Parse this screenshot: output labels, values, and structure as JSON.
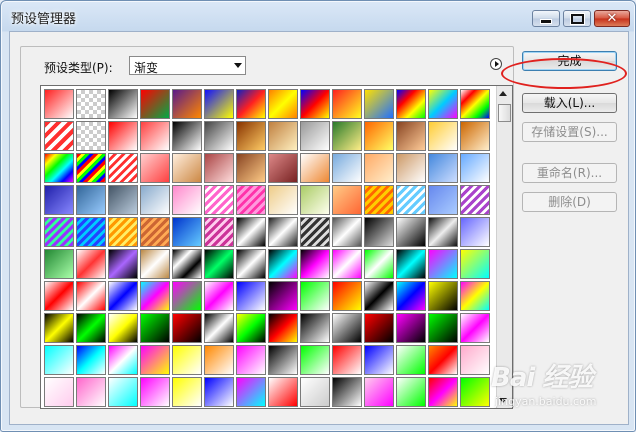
{
  "window": {
    "title": "预设管理器"
  },
  "preset": {
    "label": "预设类型(P):",
    "value": "渐变"
  },
  "buttons": {
    "done": "完成",
    "load": "载入(L)...",
    "save": "存储设置(S)...",
    "rename": "重命名(R)...",
    "delete": "删除(D)"
  },
  "watermark": {
    "logo": "Bai 经验",
    "url": "jingyan.baidu.com"
  },
  "colors": {
    "highlight_ring": "#e0211e",
    "default_button_border": "#3c7fb1"
  },
  "icons": {
    "menu": "flyout-menu-icon",
    "scroll_up": "scroll-up-arrow-icon",
    "scroll_down": "scroll-down-arrow-icon"
  },
  "swatches": [
    "linear-gradient(135deg,#ff2020,#ffffff)",
    "checker",
    "linear-gradient(135deg,#000000,#ffffff)",
    "linear-gradient(135deg,#ff0000,#00aa44)",
    "linear-gradient(135deg,#5a1a8a,#ff8800)",
    "linear-gradient(135deg,#1010ff,#ffff00)",
    "linear-gradient(135deg,#1020c0,#ff2020,#ffff00)",
    "linear-gradient(135deg,#ff8000,#ffff00,#ff8000)",
    "linear-gradient(135deg,#0000ff,#ff0000,#ffff00)",
    "linear-gradient(135deg,#ff2020,#ffff20)",
    "linear-gradient(135deg,#ffe000,#2070ff)",
    "linear-gradient(135deg,#0000ff,#ff0000,#ffff00,#00ff00)",
    "linear-gradient(135deg,#ffff00,#00ccff,#ff00ff)",
    "linear-gradient(135deg,#ffffff,#ff0000,#ffff00,#00ff00,#0000ff)",
    "repeating-linear-gradient(135deg,#ff3030 0 4px,#ffffff 4px 8px)",
    "checker",
    "linear-gradient(135deg,#ff0000,#ffffff)",
    "linear-gradient(135deg,#ff4040,#ffffff)",
    "linear-gradient(135deg,#000000,#ffffff)",
    "linear-gradient(135deg,#444444,#ffffff)",
    "linear-gradient(135deg,#883300,#ffcc66)",
    "linear-gradient(135deg,#c08040,#fff0c0)",
    "linear-gradient(135deg,#999999,#ffffff)",
    "linear-gradient(135deg,#2a7a2a,#ffee88)",
    "linear-gradient(135deg,#ff6600,#ffff66)",
    "linear-gradient(135deg,#884422,#ffcc99)",
    "linear-gradient(135deg,#ffcc33,#ffffff)",
    "linear-gradient(135deg,#cc6600,#ffeecc)",
    "linear-gradient(135deg,#ff0000,#ffff00,#00ff00,#00ffff,#0000ff,#ff00ff)",
    "repeating-linear-gradient(135deg,#ff0000 0 3px,#ffff00 3px 6px,#00ff00 6px 9px,#0000ff 9px 12px)",
    "repeating-linear-gradient(135deg,#ffffff 0 3px,#ff3030 3px 6px)",
    "linear-gradient(135deg,#ffd0d0,#ff4040)",
    "linear-gradient(135deg,#ffeedd,#cc8844)",
    "linear-gradient(135deg,#aa4444,#ffdddd)",
    "linear-gradient(135deg,#884422,#ffcc88)",
    "linear-gradient(135deg,#dd8888,#772222)",
    "linear-gradient(135deg,#ffffff,#ee8833)",
    "linear-gradient(135deg,#77aadd,#ffffff)",
    "linear-gradient(135deg,#ffaa66,#ffeecc)",
    "linear-gradient(135deg,#cc9966,#ffffff)",
    "linear-gradient(135deg,#4488dd,#ccddff)",
    "linear-gradient(135deg,#66aaff,#ffffff)",
    "linear-gradient(135deg,#2020aa,#8888ff)",
    "linear-gradient(135deg,#336699,#99ccff)",
    "linear-gradient(135deg,#445566,#bbccdd)",
    "linear-gradient(135deg,#88aacc,#ffffff)",
    "linear-gradient(135deg,#ff88cc,#ffffff)",
    "repeating-linear-gradient(135deg,#ff66cc 0 3px,#ffffff 3px 6px)",
    "repeating-linear-gradient(135deg,#ff99dd 0 3px,#ff33aa 3px 6px)",
    "linear-gradient(135deg,#eecc88,#ffffff)",
    "linear-gradient(135deg,#aacc66,#ffffee)",
    "linear-gradient(135deg,#ffcc88,#ff6633)",
    "repeating-linear-gradient(135deg,#ffcc00 0 3px,#ff6600 3px 6px)",
    "repeating-linear-gradient(135deg,#66ccff 0 3px,#ffffff 3px 6px)",
    "linear-gradient(135deg,#6688ee,#aaccff)",
    "repeating-linear-gradient(135deg,#aa44cc 0 3px,#ffffff 3px 6px)",
    "repeating-linear-gradient(135deg,#9933ff 0 3px,#33ff99 3px 6px)",
    "repeating-linear-gradient(135deg,#2244ff 0 3px,#00ccff 3px 6px)",
    "repeating-linear-gradient(135deg,#ff9900 0 3px,#ffee66 3px 6px)",
    "repeating-linear-gradient(135deg,#cc6633 0 3px,#ffaa55 3px 6px)",
    "linear-gradient(135deg,#0033cc,#66ccff)",
    "repeating-linear-gradient(135deg,#cc3399 0 3px,#ffccee 3px 6px)",
    "linear-gradient(135deg,#000000,#ffffff,#000000)",
    "linear-gradient(135deg,#222222,#ffffff,#222222)",
    "repeating-linear-gradient(135deg,#333333 0 3px,#dddddd 3px 6px)",
    "linear-gradient(135deg,#555555,#ffffff,#555555)",
    "linear-gradient(135deg,#000000,#dddddd)",
    "linear-gradient(135deg,#ffffff,#000000)",
    "linear-gradient(135deg,#111111,#eeeeee,#111111)",
    "linear-gradient(135deg,#6666ff,#ffffff)",
    "linear-gradient(135deg,#228833,#aaffaa)",
    "linear-gradient(135deg,#ffffff,#ff3333,#ffffff)",
    "linear-gradient(135deg,#000000,#aa66ff,#000000)",
    "linear-gradient(135deg,#bb8844,#ffffff,#bb8844)",
    "linear-gradient(135deg,#000000,#ffffff,#000000,#ffffff)",
    "linear-gradient(135deg,#000000,#00ff66,#000000)",
    "linear-gradient(135deg,#000000,#ffffff,#000000)",
    "linear-gradient(135deg,#000000,#00ffff,#ff00ff)",
    "linear-gradient(135deg,#000000,#ff00ff,#ffffff)",
    "linear-gradient(135deg,#ff00ff,#ffffff,#ff00ff)",
    "linear-gradient(135deg,#00ff00,#ffffff,#00ff00)",
    "linear-gradient(135deg,#000000,#00ffff,#000000)",
    "linear-gradient(135deg,#ff00ff,#00ffff)",
    "linear-gradient(135deg,#ffff00,#00ffff)",
    "linear-gradient(135deg,#ffffff,#ff0000,#ffffff)",
    "linear-gradient(135deg,#ff0000,#ffffff,#ff0000)",
    "linear-gradient(135deg,#ffffff,#0000ff,#ffffff)",
    "linear-gradient(135deg,#00ffff,#ff00ff,#ffff00)",
    "linear-gradient(135deg,#ff00ff,#00ff00)",
    "linear-gradient(135deg,#ffffff,#ff00ff,#ffffff)",
    "linear-gradient(135deg,#0000ff,#ffffff)",
    "linear-gradient(135deg,#000000,#ff00ff)",
    "linear-gradient(135deg,#00ff00,#ffffff)",
    "linear-gradient(135deg,#ff0000,#ffff00)",
    "linear-gradient(135deg,#ffffff,#000000,#ffffff)",
    "linear-gradient(135deg,#00ffff,#0000ff,#ff00ff)",
    "linear-gradient(135deg,#ffff00,#000000)",
    "linear-gradient(135deg,#ff00ff,#ffff00,#00ffff)",
    "linear-gradient(135deg,#000000,#ffff00,#000000)",
    "linear-gradient(135deg,#000000,#00ff00,#000000)",
    "linear-gradient(135deg,#ffffff,#ffff00,#000000)",
    "linear-gradient(135deg,#00ff00,#000000)",
    "linear-gradient(135deg,#ff0000,#000000)",
    "linear-gradient(135deg,#000000,#ffffff,#000000)",
    "linear-gradient(135deg,#ffff00,#00ff00,#000000)",
    "linear-gradient(135deg,#000000,#ff0000,#ffff00)",
    "linear-gradient(135deg,#000000,#ffffff)",
    "linear-gradient(135deg,#ffffff,#000000)",
    "linear-gradient(135deg,#ff0000,#000000)",
    "linear-gradient(135deg,#ff00ff,#000000)",
    "linear-gradient(135deg,#00ff00,#000000)",
    "linear-gradient(135deg,#ffffff,#ff00ff,#ffffff)",
    "linear-gradient(135deg,#00ffff,#ffffff)",
    "linear-gradient(135deg,#0000ff,#00ffff,#ffffff)",
    "linear-gradient(135deg,#ff00ff,#ffffff,#00ffff)",
    "linear-gradient(135deg,#ff00ff,#ffff00)",
    "linear-gradient(135deg,#ffff00,#ffffff)",
    "linear-gradient(135deg,#ff8800,#ffffff)",
    "linear-gradient(135deg,#ff00ff,#ffffff)",
    "linear-gradient(135deg,#000000,#ffffff)",
    "linear-gradient(135deg,#00ff00,#ffffff)",
    "linear-gradient(135deg,#ff0000,#ffffff)",
    "linear-gradient(135deg,#0000ff,#ffffff)",
    "linear-gradient(135deg,#ffffff,#00ff00)",
    "linear-gradient(135deg,#ff8800,#ff0000,#ffffff)",
    "linear-gradient(135deg,#ffaacc,#ffffff)",
    "linear-gradient(135deg,#ffffff,#ffccee)",
    "linear-gradient(135deg,#ff66cc,#ffffff)",
    "linear-gradient(135deg,#ffffff,#00ffff)",
    "linear-gradient(135deg,#ff00ff,#ffffff)",
    "linear-gradient(135deg,#ffff00,#ffffff)",
    "linear-gradient(135deg,#0000ff,#ffffff)",
    "linear-gradient(135deg,#ff00ff,#00ffff)",
    "linear-gradient(135deg,#ffffff,#ff0000)",
    "linear-gradient(135deg,#ffffff,#cccccc)",
    "linear-gradient(135deg,#000000,#ffffff)",
    "linear-gradient(135deg,#ffccee,#ff00ff)",
    "linear-gradient(135deg,#ffffff,#00ff00)",
    "linear-gradient(135deg,#ff0000,#ff00ff,#ffff00)",
    "linear-gradient(135deg,#00ff00,#ffff00)",
    "linear-gradient(135deg,#00ffff,#ff00ff)",
    "linear-gradient(135deg,#ffff00,#ff0000)",
    "linear-gradient(135deg,#ff00ff,#00ff00,#ffff00)",
    "linear-gradient(135deg,#000000,#ff00ff)",
    "linear-gradient(135deg,#00ffff,#ffffff)",
    "linear-gradient(135deg,#ff0000,#ffffff,#00ff00)",
    "linear-gradient(135deg,#ffff00,#00ffff,#ff00ff)",
    "linear-gradient(135deg,#ffffff,#ff00ff,#000000)",
    "linear-gradient(135deg,#ff0000,#000000,#ffff00)",
    "linear-gradient(135deg,#ffffff,#ffff00)",
    "linear-gradient(135deg,#000000,#ffff00)",
    "linear-gradient(135deg,#00ff00,#000000)"
  ]
}
